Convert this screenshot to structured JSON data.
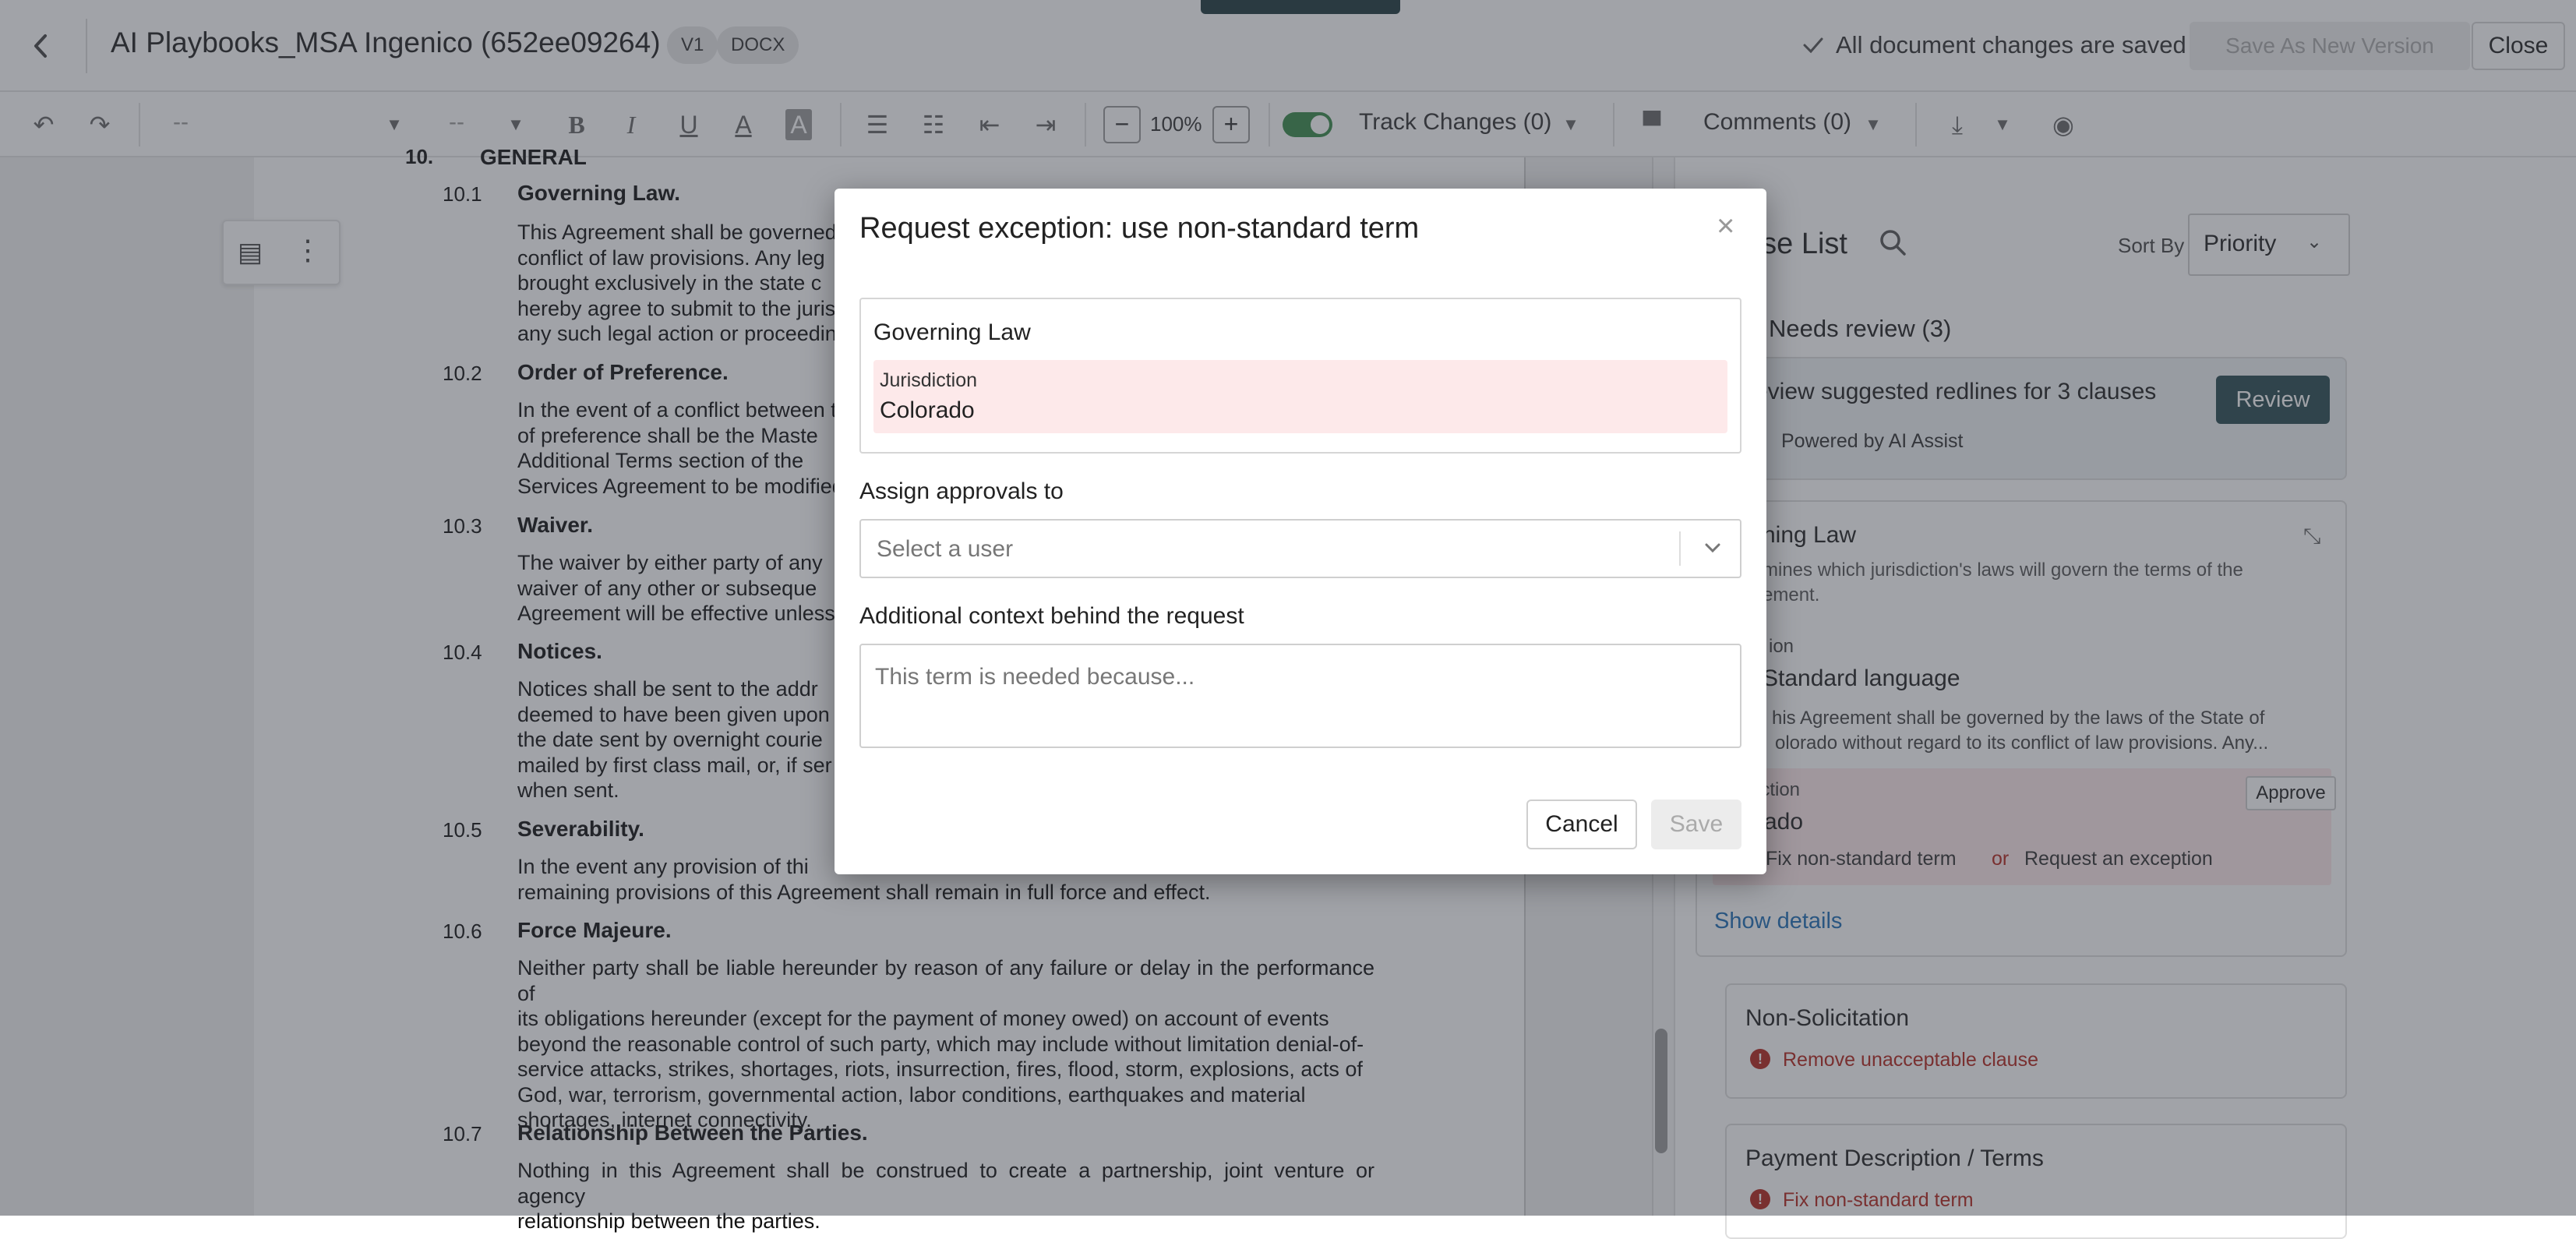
{
  "header": {
    "title": "AI Playbooks_MSA Ingenico (652ee09264)",
    "version_badge": "V1",
    "format_badge": "DOCX",
    "save_status": "All document changes are saved",
    "save_as_label": "Save As New Version",
    "close_label": "Close"
  },
  "toolbar": {
    "font_family": "--",
    "font_size": "--",
    "zoom": "100%",
    "track_changes": "Track Changes (0)",
    "comments": "Comments (0)"
  },
  "document": {
    "s10_num": "10.",
    "s10_title": "GENERAL",
    "sections": [
      {
        "num": "10.1",
        "title": "Governing Law.",
        "lines": [
          "This Agreement shall be governed",
          "conflict of law provisions.  Any leg",
          "brought exclusively in the state c",
          "hereby agree to submit to the juris",
          "any such legal action or proceedin"
        ]
      },
      {
        "num": "10.2",
        "title": "Order of Preference.",
        "lines": [
          "In the event of a conflict between t",
          "of preference shall be the Maste",
          "Additional Terms section of the",
          "Services Agreement to be modified"
        ]
      },
      {
        "num": "10.3",
        "title": "Waiver.",
        "lines": [
          "The waiver by either party of any",
          "waiver of any other or subseque",
          "Agreement will be effective unless"
        ]
      },
      {
        "num": "10.4",
        "title": "Notices.",
        "lines": [
          "Notices shall be sent to the addr",
          "deemed to have been given upon",
          "the date sent by overnight courie",
          "mailed by first class mail, or, if ser",
          "when sent."
        ]
      },
      {
        "num": "10.5",
        "title": "Severability.",
        "lines": [
          "In the event any provision of thi",
          "remaining provisions of this Agreement shall remain in full force and effect."
        ]
      },
      {
        "num": "10.6",
        "title": "Force Majeure.",
        "lines": [
          "Neither party shall be liable hereunder by reason of any failure or delay in the performance of",
          "its obligations hereunder (except for the payment of money owed) on account of events",
          "beyond the reasonable control of such party, which may include without limitation denial-of-",
          "service attacks, strikes, shortages, riots, insurrection, fires, flood, storm, explosions, acts of",
          "God, war, terrorism, governmental action, labor conditions, earthquakes and material",
          "shortages, internet connectivity."
        ]
      },
      {
        "num": "10.7",
        "title": "Relationship Between the Parties.",
        "lines": [
          "Nothing in this Agreement shall be construed to create a partnership, joint venture or agency",
          "relationship between the parties."
        ]
      }
    ]
  },
  "panel": {
    "title": "use List",
    "sort_by_label": "Sort By",
    "sort_value": "Priority",
    "needs_review": "Needs review (3)",
    "suggest_title": "eview suggested redlines for 3 clauses",
    "review_button": "Review",
    "powered_by": "Powered by AI Assist",
    "governing": {
      "title": "rning Law",
      "desc_1": "mines which jurisdiction's laws will govern the terms of the",
      "desc_2": "ement.",
      "sub_label": "ion",
      "standard": "Standard language",
      "excerpt_1": "his Agreement shall be governed by the laws of the State of",
      "excerpt_2": "olorado without regard to its conflict of law provisions. Any...",
      "juris_label": "iction",
      "juris_value": "rado",
      "approve": "Approve",
      "fix": "Fix non-standard term",
      "or": "or",
      "request": "Request an exception",
      "show_details": "Show details"
    },
    "non_solicitation": {
      "title": "Non-Solicitation",
      "action": "Remove unacceptable clause"
    },
    "payment": {
      "title": "Payment Description / Terms",
      "action": "Fix non-standard term"
    }
  },
  "modal": {
    "title": "Request exception: use non-standard term",
    "close_symbol": "×",
    "clause_name": "Governing Law",
    "field_label": "Jurisdiction",
    "field_value": "Colorado",
    "assign_label": "Assign approvals to",
    "assign_placeholder": "Select a user",
    "context_label": "Additional context behind the request",
    "context_placeholder": "This term is needed because...",
    "cancel": "Cancel",
    "save": "Save"
  },
  "colors": {
    "accent_dark": "#2b4d52",
    "error": "#b3261e",
    "link": "#1f6fb5",
    "highlight": "#fde9ea"
  }
}
